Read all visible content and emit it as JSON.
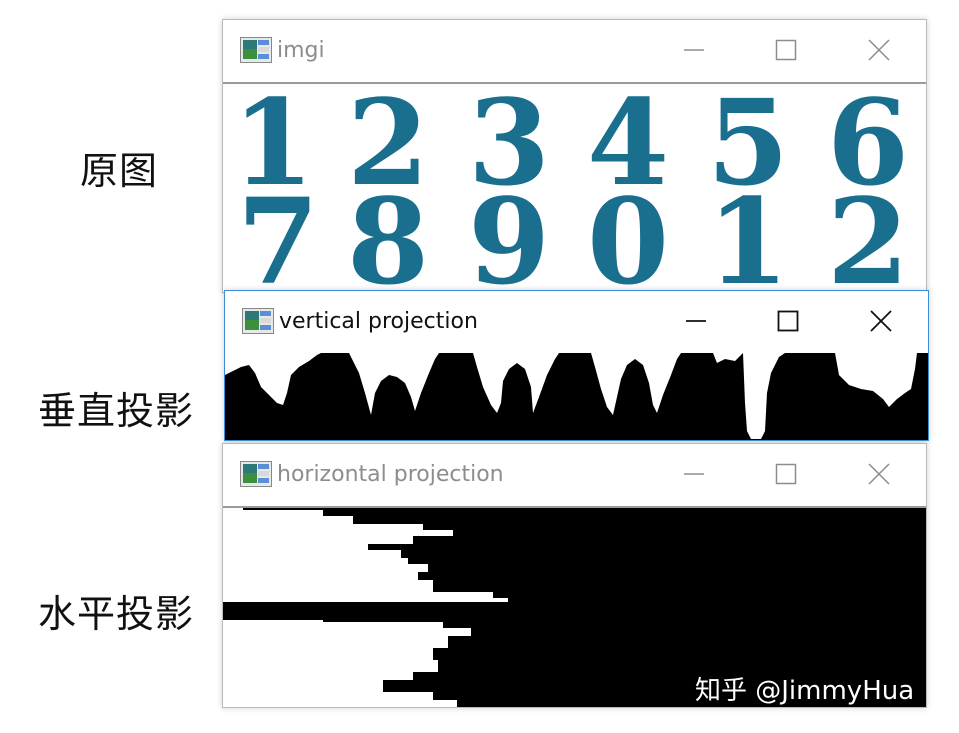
{
  "labels": {
    "original": "原图",
    "vertical": "垂直投影",
    "horizontal": "水平投影"
  },
  "windows": {
    "imgi": {
      "title": "imgi",
      "digits_row1": [
        "1",
        "2",
        "3",
        "4",
        "5",
        "6"
      ],
      "digits_row2": [
        "7",
        "8",
        "9",
        "0",
        "1",
        "2"
      ]
    },
    "vertical": {
      "title": "vertical projection"
    },
    "horizontal": {
      "title": "horizontal projection"
    }
  },
  "icons": {
    "app": "app-icon",
    "minimize": "minimize-icon",
    "maximize": "maximize-icon",
    "close": "close-icon"
  },
  "watermark": "知乎 @JimmyHua",
  "colors": {
    "digit": "#1a6f8f",
    "projection_fg": "#ffffff",
    "projection_bg": "#000000",
    "active_border": "#3c8fd6",
    "inactive_title": "#8d8d8d"
  }
}
